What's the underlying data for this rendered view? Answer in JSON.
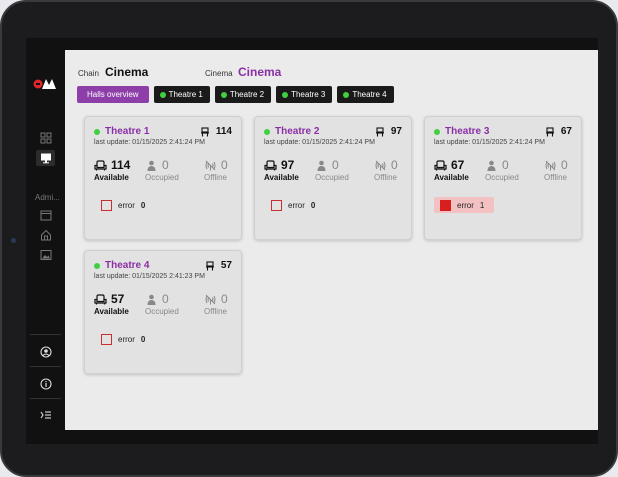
{
  "header": {
    "chain_label": "Chain",
    "chain_value": "Cinema",
    "cinema_label": "Cinema",
    "cinema_value": "Cinema"
  },
  "sidebar": {
    "section_label": "Admi..."
  },
  "tabs": [
    {
      "label": "Halls overview",
      "active": true
    },
    {
      "label": "Theatre 1"
    },
    {
      "label": "Theatre 2"
    },
    {
      "label": "Theatre 3"
    },
    {
      "label": "Theatre 4"
    }
  ],
  "stat_labels": {
    "available": "Available",
    "occupied": "Occupied",
    "offline": "Offline",
    "error": "error"
  },
  "theatres": [
    {
      "name": "Theatre 1",
      "last_update": "last update: 01/15/2025 2:41:24 PM",
      "capacity": "114",
      "available": "114",
      "occupied": "0",
      "offline": "0",
      "errors": "0"
    },
    {
      "name": "Theatre 2",
      "last_update": "last update: 01/15/2025 2:41:24 PM",
      "capacity": "97",
      "available": "97",
      "occupied": "0",
      "offline": "0",
      "errors": "0"
    },
    {
      "name": "Theatre 3",
      "last_update": "last update: 01/15/2025 2:41:24 PM",
      "capacity": "67",
      "available": "67",
      "occupied": "0",
      "offline": "0",
      "errors": "1"
    },
    {
      "name": "Theatre 4",
      "last_update": "last update: 01/15/2025 2:41:23 PM",
      "capacity": "57",
      "available": "57",
      "occupied": "0",
      "offline": "0",
      "errors": "0"
    }
  ],
  "colors": {
    "accent": "#8b2fa6",
    "online": "#3fcf3f",
    "error": "#d81f1f"
  }
}
